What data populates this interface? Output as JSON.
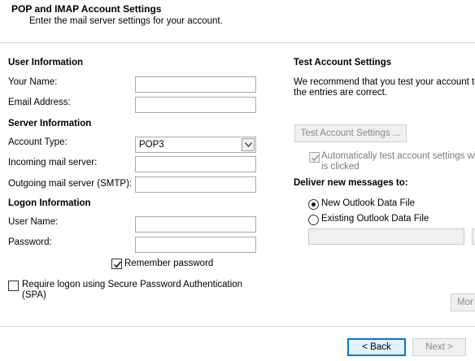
{
  "header": {
    "title": "POP and IMAP Account Settings",
    "subtitle": "Enter the mail server settings for your account."
  },
  "user_info": {
    "heading": "User Information",
    "your_name_label": "Your Name:",
    "email_label": "Email Address:",
    "your_name_value": "",
    "email_value": ""
  },
  "server_info": {
    "heading": "Server Information",
    "account_type_label": "Account Type:",
    "account_type_value": "POP3",
    "incoming_label": "Incoming mail server:",
    "outgoing_label": "Outgoing mail server (SMTP):",
    "incoming_value": "",
    "outgoing_value": ""
  },
  "logon_info": {
    "heading": "Logon Information",
    "username_label": "User Name:",
    "password_label": "Password:",
    "username_value": "",
    "password_value": "",
    "remember_password_label": "Remember password",
    "remember_password_checked": true,
    "spa_label_line1": "Require logon using Secure Password Authentication",
    "spa_label_line2": "(SPA)",
    "spa_checked": false
  },
  "test_settings": {
    "heading": "Test Account Settings",
    "desc_line1": "We recommend that you test your account to",
    "desc_line2": "the entries are correct.",
    "test_button_label": "Test Account Settings ...",
    "auto_test_line1": "Automatically test account settings wh",
    "auto_test_line2": "is clicked",
    "auto_test_checked": true
  },
  "deliver": {
    "heading": "Deliver new messages to:",
    "new_file_label": "New Outlook Data File",
    "existing_file_label": "Existing Outlook Data File",
    "selected": "new",
    "existing_path_value": ""
  },
  "buttons": {
    "more_label": "Mor",
    "back_label": "< Back",
    "next_label": "Next >"
  }
}
